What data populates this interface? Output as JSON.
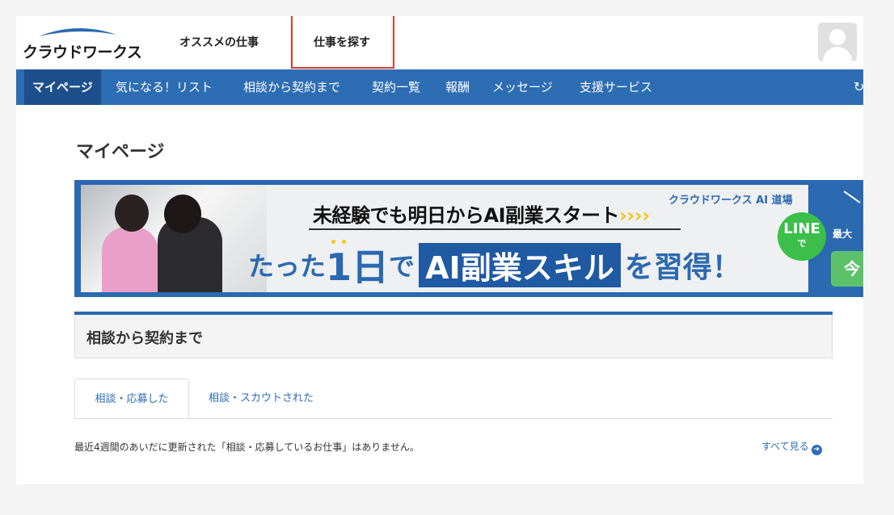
{
  "header": {
    "logo_text": "クラウドワークス",
    "links": [
      "オススメの仕事",
      "仕事を探す"
    ]
  },
  "nav": {
    "items": [
      "マイページ",
      "気になる！リスト",
      "相談から契約まで",
      "契約一覧",
      "報酬",
      "メッセージ",
      "支援サービス"
    ]
  },
  "page": {
    "title": "マイページ"
  },
  "banner": {
    "headline": "未経験でも明日からAI副業スタート",
    "headline_chevrons": "››››",
    "brand": "クラウドワークス AI 道場",
    "sub_prefix": "たった",
    "sub_num": "1日",
    "sub_de": "で",
    "sub_skill": "AI副業スキル",
    "sub_suffix": "を習得！",
    "line_label": "LINE",
    "line_de": "で",
    "right_text": "最大",
    "right_button": "今"
  },
  "section": {
    "title": "相談から契約まで",
    "tabs": [
      "相談・応募した",
      "相談・スカウトされた"
    ],
    "empty_message": "最近4週間のあいだに更新された「相談・応募しているお仕事」はありません。",
    "see_all": "すべて見る"
  },
  "colors": {
    "brand_blue": "#2d6db3",
    "nav_active": "#1d4f8c",
    "highlight_red": "#e03b30"
  }
}
